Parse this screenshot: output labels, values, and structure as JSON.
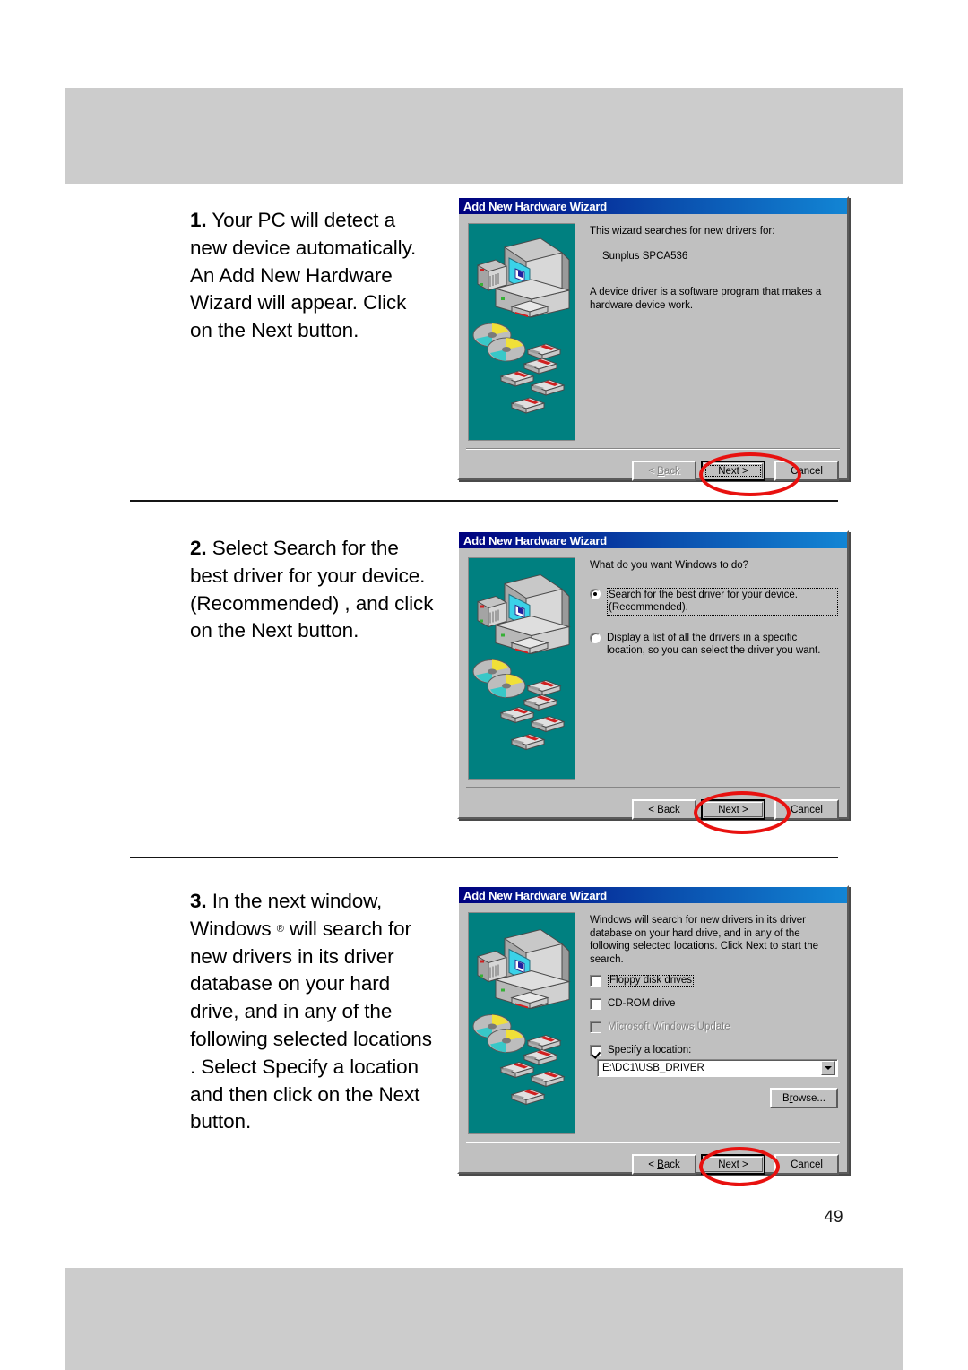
{
  "page": {
    "page_number": "49",
    "band_color": "#cccccc"
  },
  "steps": [
    {
      "number": "1.",
      "text": " Your PC will detect a new device automatically. An  Add New Hardware Wizard  will appear. Click on the  Next  button."
    },
    {
      "number": "2.",
      "text": " Select  Search for the best driver for your device. (Recommended) , and click on the  Next  button."
    },
    {
      "number": "3.",
      "text_a": " In the next window, Windows ",
      "tiny": "®",
      "text_b": " will search for new drivers in its driver database on your hard drive, and in any of the following selected locations .  Select  Specify a location  and then click on the  Next  button."
    }
  ],
  "dialogs": [
    {
      "title": "Add New Hardware Wizard",
      "body_line1": "This wizard searches for new drivers for:",
      "device_name": "Sunplus SPCA536",
      "body_line2": "A device driver is a software program that makes a hardware device work.",
      "buttons": {
        "back": "< Back",
        "back_accel": "B",
        "next": "Next >",
        "cancel": "Cancel"
      }
    },
    {
      "title": "Add New Hardware Wizard",
      "question": "What do you want Windows to do?",
      "options": [
        {
          "label_line1": "Search for the best driver for your device.",
          "label_line2": "(Recommended).",
          "selected": true
        },
        {
          "label_line1": "Display a list of all the drivers in a specific",
          "label_line2": "location, so you can select the driver you want.",
          "selected": false
        }
      ],
      "buttons": {
        "back": "< Back",
        "back_accel": "B",
        "next": "Next >",
        "cancel": "Cancel"
      }
    },
    {
      "title": "Add New Hardware Wizard",
      "body_line1": "Windows will search for new drivers in its driver database on your hard drive, and in any of the following selected locations. Click Next to start the search.",
      "checkboxes": [
        {
          "label": "Floppy disk drives",
          "checked": false,
          "disabled": false,
          "focused": true
        },
        {
          "label": "CD-ROM drive",
          "checked": false,
          "disabled": false,
          "focused": false
        },
        {
          "label": "Microsoft Windows Update",
          "checked": false,
          "disabled": true,
          "focused": false
        },
        {
          "label": "Specify a location:",
          "checked": true,
          "disabled": false,
          "focused": false
        }
      ],
      "location_value": "E:\\DC1\\USB_DRIVER",
      "browse_label": "Browse...",
      "buttons": {
        "back": "< Back",
        "back_accel": "B",
        "next": "Next >",
        "cancel": "Cancel"
      }
    }
  ],
  "colors": {
    "title_gradient_start": "#00007e",
    "title_gradient_end": "#1285d4",
    "dialog_face": "#c0c0c0",
    "banner_teal": "#008080",
    "annotation_red": "#e8110f"
  }
}
